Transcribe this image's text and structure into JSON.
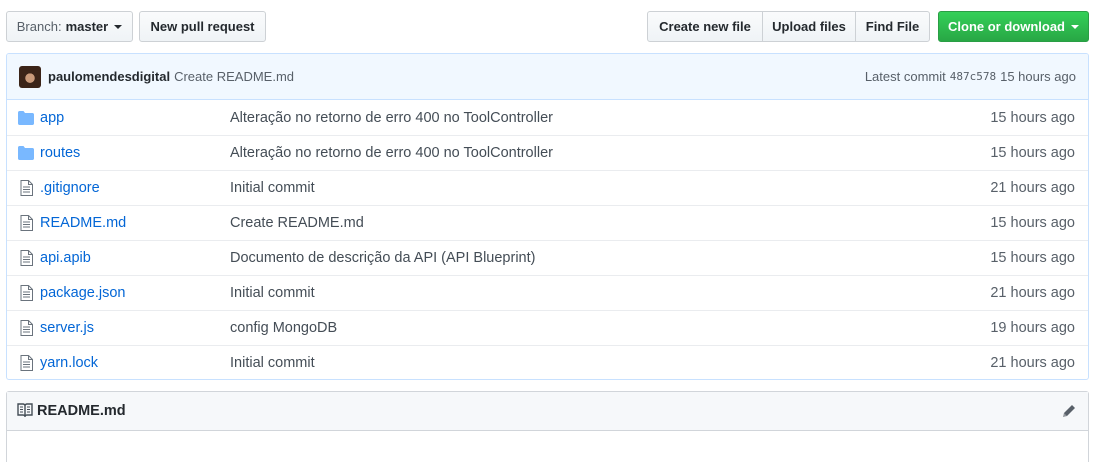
{
  "toolbar": {
    "branch_label": "Branch:",
    "branch_value": "master",
    "new_pull_request": "New pull request",
    "create_new_file": "Create new file",
    "upload_files": "Upload files",
    "find_file": "Find File",
    "clone_or_download": "Clone or download"
  },
  "commit_tease": {
    "author": "paulomendesdigital",
    "message": "Create README.md",
    "latest_label": "Latest commit",
    "sha": "487c578",
    "age": "15 hours ago"
  },
  "files": [
    {
      "type": "folder",
      "name": "app",
      "message": "Alteração no retorno de erro 400 no ToolController",
      "age": "15 hours ago"
    },
    {
      "type": "folder",
      "name": "routes",
      "message": "Alteração no retorno de erro 400 no ToolController",
      "age": "15 hours ago"
    },
    {
      "type": "file",
      "name": ".gitignore",
      "message": "Initial commit",
      "age": "21 hours ago"
    },
    {
      "type": "file",
      "name": "README.md",
      "message": "Create README.md",
      "age": "15 hours ago"
    },
    {
      "type": "file",
      "name": "api.apib",
      "message": "Documento de descrição da API (API Blueprint)",
      "age": "15 hours ago"
    },
    {
      "type": "file",
      "name": "package.json",
      "message": "Initial commit",
      "age": "21 hours ago"
    },
    {
      "type": "file",
      "name": "server.js",
      "message": "config MongoDB",
      "age": "19 hours ago"
    },
    {
      "type": "file",
      "name": "yarn.lock",
      "message": "Initial commit",
      "age": "21 hours ago"
    }
  ],
  "readme": {
    "title": "README.md"
  },
  "colors": {
    "link": "#0366d6",
    "folder_icon": "#79b8ff",
    "green_button": "#28a745",
    "commit_tease_bg": "#f1f8ff"
  },
  "icons": {
    "folder": "folder-icon",
    "file": "file-icon",
    "book": "book-icon",
    "pencil": "pencil-icon"
  }
}
